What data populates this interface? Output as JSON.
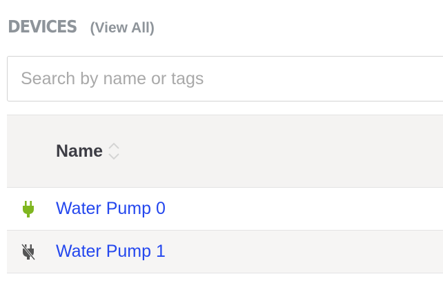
{
  "header": {
    "title": "DEVICES",
    "view_all_label": "(View All)"
  },
  "search": {
    "placeholder": "Search by name or tags",
    "value": ""
  },
  "table": {
    "columns": [
      {
        "label": "Name",
        "sort_icon": "sort-up-down-icon"
      }
    ],
    "rows": [
      {
        "name": "Water Pump 0",
        "status": "connected",
        "status_icon": "plug-connected-icon",
        "status_color": "#7fb620"
      },
      {
        "name": "Water Pump 1",
        "status": "disconnected",
        "status_icon": "plug-disconnected-icon",
        "status_color": "#555555"
      }
    ]
  }
}
